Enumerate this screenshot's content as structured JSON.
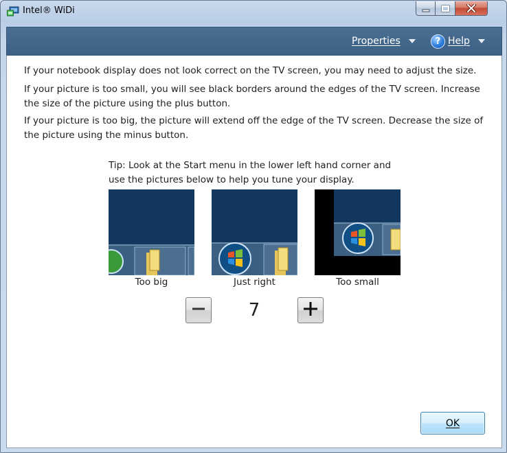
{
  "window": {
    "title": "Intel® WiDi",
    "controls": {
      "minimize": "minimize",
      "maximize": "maximize",
      "close": "close"
    }
  },
  "menubar": {
    "properties_label": "Properties",
    "help_label": "Help",
    "help_icon_glyph": "?"
  },
  "content": {
    "paragraphs": [
      "If your notebook display does not look correct on the TV screen, you may need to adjust the size.",
      "If your picture is too small, you will see black borders around the edges of the TV screen. Increase the size of the picture using the plus button.",
      "If your picture is too big, the picture will extend off the edge of the TV screen. Decrease the size of the picture using the minus button."
    ],
    "tip": "Tip: Look at the Start menu in the lower left hand corner and use the pictures below to help you tune your display.",
    "thumbnails": [
      {
        "label": "Too big"
      },
      {
        "label": "Just right"
      },
      {
        "label": "Too small"
      }
    ],
    "stepper": {
      "value": "7",
      "minus_icon": "minus-icon",
      "plus_icon": "plus-icon"
    }
  },
  "footer": {
    "ok_label": "OK"
  },
  "colors": {
    "menubar": "#3d6185",
    "desktop_blue": "#12385f",
    "taskbar": "#3b5f82",
    "ok_border": "#3c7fb1"
  }
}
